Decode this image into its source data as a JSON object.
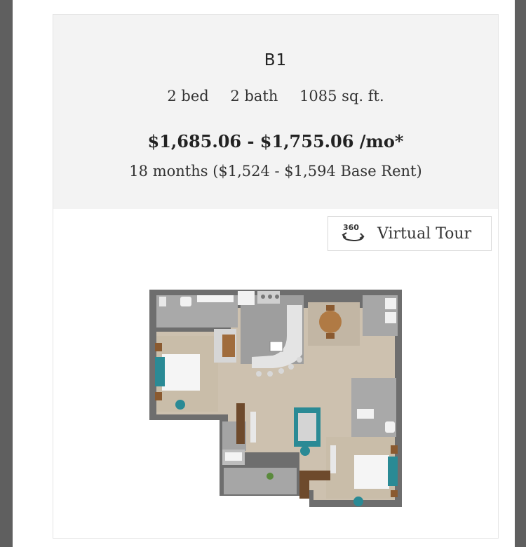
{
  "unit": {
    "name": "B1",
    "beds": "2 bed",
    "baths": "2 bath",
    "area": "1085 sq. ft.",
    "price": "$1,685.06 - $1,755.06 /mo*",
    "lease": "18 months ($1,524 - $1,594 Base Rent)"
  },
  "virtual_tour": {
    "label": "Virtual Tour",
    "icon_text": "360",
    "icon": "360-rotate-icon"
  },
  "colors": {
    "header_bg": "#f3f3f3",
    "frame_bg": "#5f5f5f",
    "floor_wood": "#cbbfae",
    "wall": "#6f6f6f",
    "accent_teal": "#2a8a95"
  }
}
